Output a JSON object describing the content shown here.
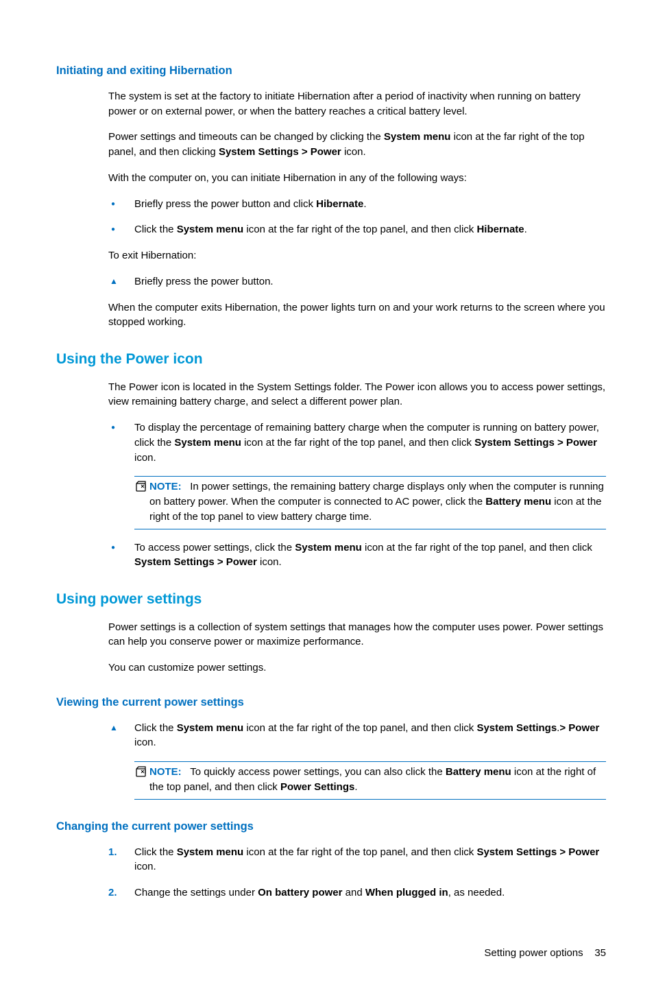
{
  "s1": {
    "heading": "Initiating and exiting Hibernation",
    "p1": "The system is set at the factory to initiate Hibernation after a period of inactivity when running on battery power or on external power, or when the battery reaches a critical battery level.",
    "p2_a": "Power settings and timeouts can be changed by clicking the ",
    "p2_b": "System menu",
    "p2_c": " icon at the far right of the top panel, and then clicking ",
    "p2_d": "System Settings > Power",
    "p2_e": " icon.",
    "p3": "With the computer on, you can initiate Hibernation in any of the following ways:",
    "b1_a": "Briefly press the power button and click ",
    "b1_b": "Hibernate",
    "b1_c": ".",
    "b2_a": "Click the ",
    "b2_b": "System menu",
    "b2_c": " icon at the far right of the top panel, and then click ",
    "b2_d": "Hibernate",
    "b2_e": ".",
    "p4": "To exit Hibernation:",
    "t1": "Briefly press the power button.",
    "p5": "When the computer exits Hibernation, the power lights turn on and your work returns to the screen where you stopped working."
  },
  "s2": {
    "heading": "Using the Power icon",
    "p1": "The Power icon is located in the System Settings folder. The Power icon allows you to access power settings, view remaining battery charge, and select a different power plan.",
    "b1_a": "To display the percentage of remaining battery charge when the computer is running on battery power, click the ",
    "b1_b": "System menu",
    "b1_c": " icon at the far right of the top panel, and then click ",
    "b1_d": "System Settings > Power",
    "b1_e": " icon.",
    "note_label": "NOTE:",
    "note_a": "In power settings, the remaining battery charge displays only when the computer is running on battery power. When the computer is connected to AC power, click the ",
    "note_b": "Battery menu",
    "note_c": " icon at the right of the top panel to view battery charge time.",
    "b2_a": "To access power settings, click the ",
    "b2_b": "System menu",
    "b2_c": " icon at the far right of the top panel, and then click ",
    "b2_d": "System Settings > Power",
    "b2_e": " icon."
  },
  "s3": {
    "heading": "Using power settings",
    "p1": "Power settings is a collection of system settings that manages how the computer uses power. Power settings can help you conserve power or maximize performance.",
    "p2": "You can customize power settings."
  },
  "s4": {
    "heading": "Viewing the current power settings",
    "t1_a": "Click the ",
    "t1_b": "System menu",
    "t1_c": " icon at the far right of the top panel, and then click ",
    "t1_d": "System Settings",
    "t1_e": ".",
    "t1_f": "> Power",
    "t1_g": " icon.",
    "note_label": "NOTE:",
    "note_a": "To quickly access power settings, you can also click the ",
    "note_b": "Battery menu",
    "note_c": " icon at the right of the top panel, and then click ",
    "note_d": "Power Settings",
    "note_e": "."
  },
  "s5": {
    "heading": "Changing the current power settings",
    "n1": "1.",
    "n1_a": "Click the ",
    "n1_b": "System menu",
    "n1_c": " icon at the far right of the top panel, and then click ",
    "n1_d": "System Settings > Power",
    "n1_e": " icon.",
    "n2": "2.",
    "n2_a": "Change the settings under ",
    "n2_b": "On battery power",
    "n2_c": " and ",
    "n2_d": "When plugged in",
    "n2_e": ", as needed."
  },
  "footer": {
    "title": "Setting power options",
    "page": "35"
  }
}
